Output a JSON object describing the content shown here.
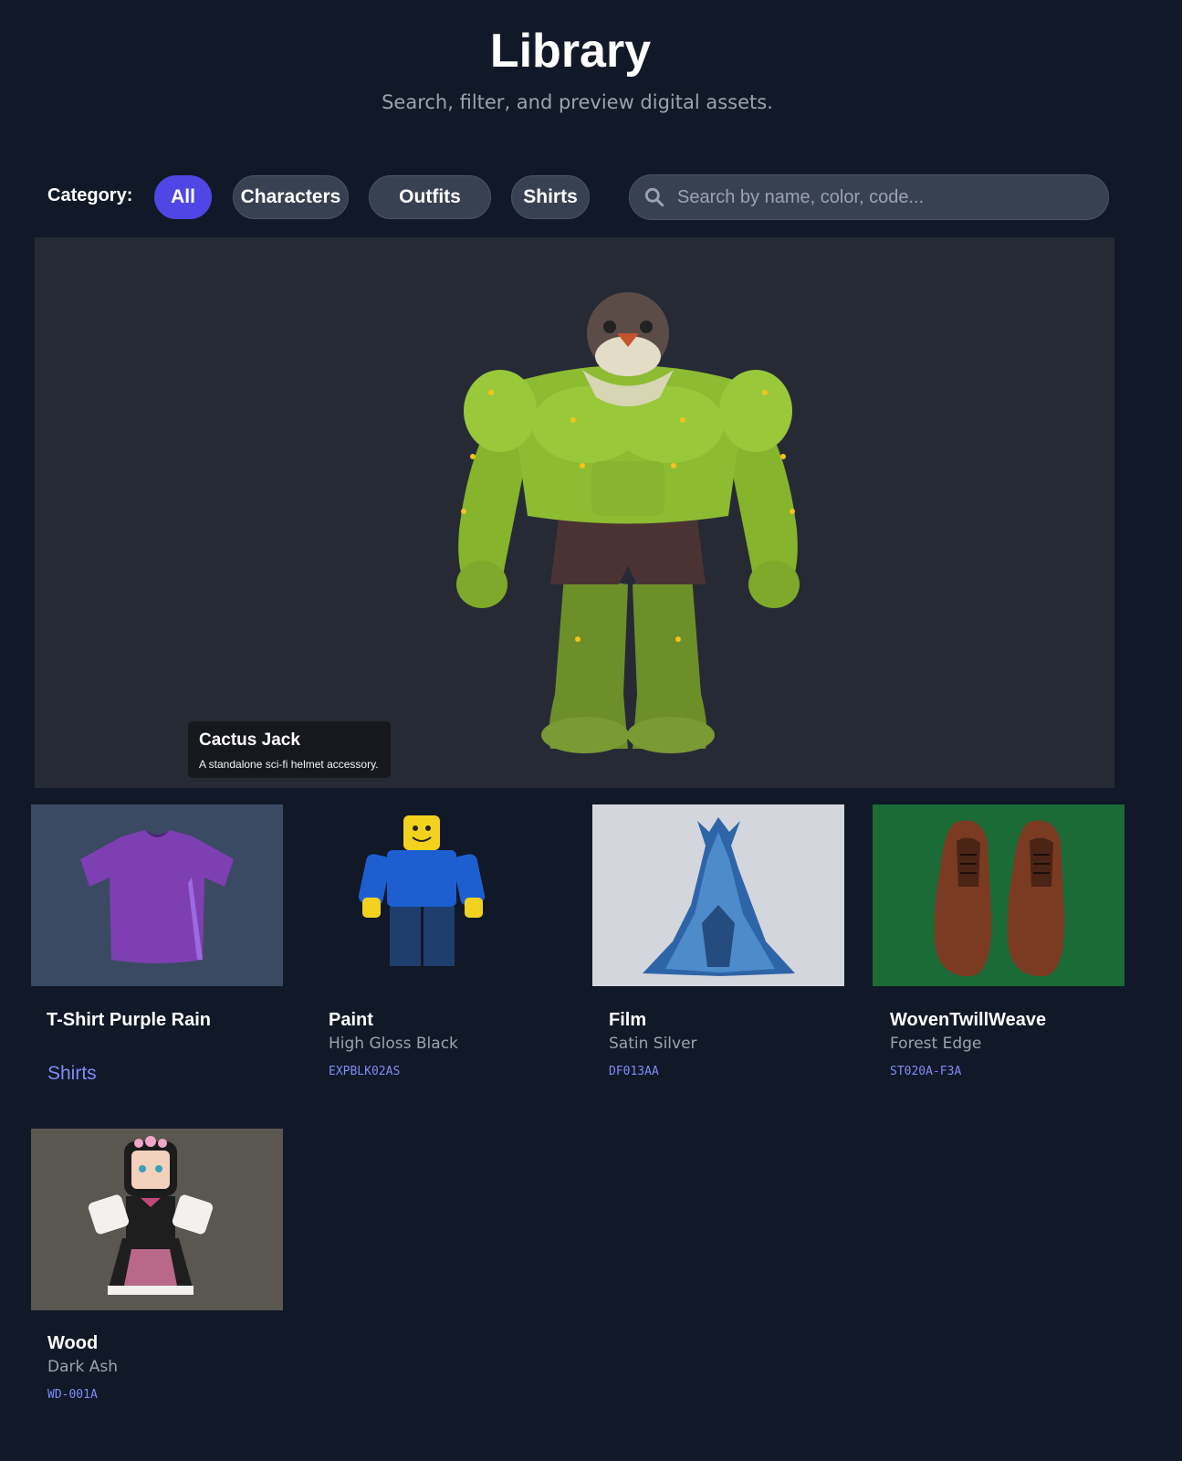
{
  "header": {
    "title": "Library",
    "subtitle": "Search, filter, and preview digital assets."
  },
  "filters": {
    "label": "Category:",
    "pills": [
      "All",
      "Characters",
      "Outfits",
      "Shirts"
    ],
    "active": "All"
  },
  "search": {
    "placeholder": "Search by name, color, code..."
  },
  "hero": {
    "name": "Cactus Jack",
    "description": "A standalone sci-fi helmet accessory."
  },
  "cards": [
    {
      "title": "T-Shirt Purple Rain",
      "category": "Shirts",
      "thumb_bg": "#3b4a63"
    },
    {
      "title": "Paint",
      "subtitle": "High Gloss Black",
      "code": "EXPBLK02AS",
      "thumb_bg": "#111827"
    },
    {
      "title": "Film",
      "subtitle": "Satin Silver",
      "code": "DF013AA",
      "thumb_bg": "#d4d6dd"
    },
    {
      "title": "WovenTwillWeave",
      "subtitle": "Forest Edge",
      "code": "ST020A-F3A",
      "thumb_bg": "#1b6b37"
    },
    {
      "title": "Wood",
      "subtitle": "Dark Ash",
      "code": "WD-001A",
      "thumb_bg": "#5a5650"
    }
  ],
  "colors": {
    "background": "#111827",
    "accent": "#4f46e5",
    "pill": "#374151",
    "code": "#818cf8"
  }
}
